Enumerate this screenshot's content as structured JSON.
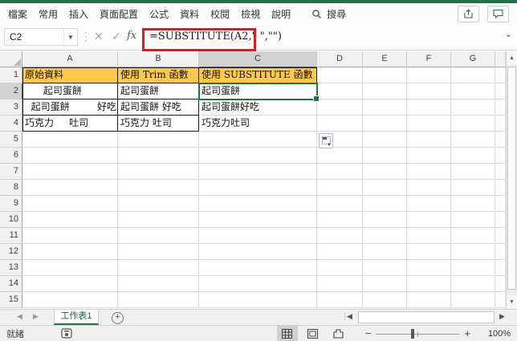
{
  "menu": {
    "items": [
      {
        "label": "檔案"
      },
      {
        "label": "常用"
      },
      {
        "label": "插入"
      },
      {
        "label": "頁面配置"
      },
      {
        "label": "公式"
      },
      {
        "label": "資料"
      },
      {
        "label": "校閱"
      },
      {
        "label": "檢視"
      },
      {
        "label": "說明"
      }
    ],
    "search_label": "搜尋"
  },
  "formula_bar": {
    "name_box_value": "C2",
    "fx_label": "fx",
    "formula": "=SUBSTITUTE(A2,\" \",\"\")"
  },
  "sheet": {
    "columns": [
      "A",
      "B",
      "C",
      "D",
      "E",
      "F",
      "G"
    ],
    "row_numbers": [
      "1",
      "2",
      "3",
      "4",
      "5",
      "6",
      "7",
      "8",
      "9",
      "10",
      "11",
      "12",
      "13",
      "14",
      "15"
    ],
    "active_cell": "C2",
    "cells": [
      {
        "ref": "A1",
        "text": "原始資料"
      },
      {
        "ref": "B1",
        "text": "使用 Trim 函數"
      },
      {
        "ref": "C1",
        "text": "使用 SUBSTITUTE 函數"
      },
      {
        "ref": "A2",
        "text": "      起司蛋餅"
      },
      {
        "ref": "B2",
        "text": "起司蛋餅"
      },
      {
        "ref": "C2",
        "text": "起司蛋餅"
      },
      {
        "ref": "A3",
        "text": "  起司蛋餅         好吃"
      },
      {
        "ref": "B3",
        "text": "起司蛋餅 好吃"
      },
      {
        "ref": "C3",
        "text": "起司蛋餅好吃"
      },
      {
        "ref": "A4",
        "text": "巧克力     吐司"
      },
      {
        "ref": "B4",
        "text": "巧克力 吐司"
      },
      {
        "ref": "C4",
        "text": "巧克力吐司"
      }
    ]
  },
  "tabs": {
    "sheet_name": "工作表1"
  },
  "status": {
    "ready_label": "就緒",
    "zoom_level": "100%"
  },
  "colors": {
    "accent_green": "#217346",
    "header_fill": "#FDC84E",
    "annotation_red": "#DE1B1E",
    "active_cell_border": "#217346"
  }
}
